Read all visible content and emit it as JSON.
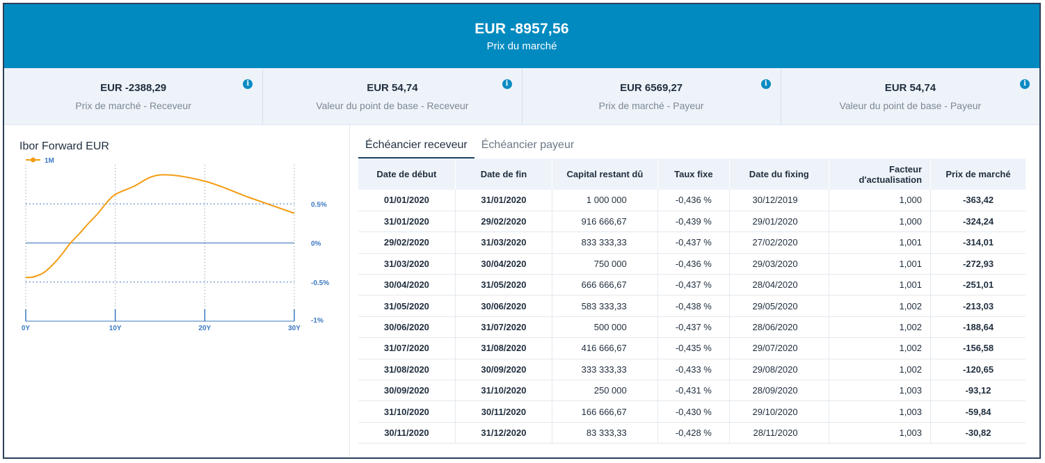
{
  "header": {
    "value": "EUR -8957,56",
    "label": "Prix du marché"
  },
  "kpis": [
    {
      "value": "EUR -2388,29",
      "label": "Prix de marché - Receveur",
      "icon": "info-icon"
    },
    {
      "value": "EUR 54,74",
      "label": "Valeur du point de base - Receveur",
      "icon": "info-icon"
    },
    {
      "value": "EUR 6569,27",
      "label": "Prix de marché - Payeur",
      "icon": "info-icon"
    },
    {
      "value": "EUR 54,74",
      "label": "Valeur du point de base - Payeur",
      "icon": "info-icon"
    }
  ],
  "info_glyph": "i",
  "chart_data": {
    "type": "line",
    "title": "Ibor Forward EUR",
    "series": [
      {
        "name": "1M",
        "color": "#f39c12",
        "x": [
          0,
          0.5,
          1,
          2,
          3,
          4,
          5,
          6,
          7,
          8,
          9,
          10,
          12,
          15,
          20,
          25,
          30
        ],
        "y": [
          -0.44,
          -0.44,
          -0.43,
          -0.38,
          -0.28,
          -0.15,
          0.0,
          0.12,
          0.25,
          0.37,
          0.51,
          0.62,
          0.72,
          0.87,
          0.79,
          0.58,
          0.38
        ]
      }
    ],
    "x_ticks": [
      "0Y",
      "10Y",
      "20Y",
      "30Y"
    ],
    "x_tick_values": [
      0,
      10,
      20,
      30
    ],
    "y_ticks": [
      "0.5%",
      "0%",
      "-0.5%",
      "-1%"
    ],
    "y_tick_values": [
      0.5,
      0,
      -0.5,
      -1
    ],
    "xlim": [
      0,
      30
    ],
    "ylim": [
      -1,
      1
    ],
    "grid": true,
    "legend": "top-left",
    "y_axis_side": "right"
  },
  "tabs": [
    {
      "label": "Échéancier receveur",
      "active": true
    },
    {
      "label": "Échéancier payeur",
      "active": false
    }
  ],
  "table": {
    "columns": [
      "Date de début",
      "Date de fin",
      "Capital restant dû",
      "Taux fixe",
      "Date du fixing",
      "Facteur d'actualisation",
      "Prix de marché"
    ],
    "rows": [
      [
        "01/01/2020",
        "31/01/2020",
        "1 000 000",
        "-0,436 %",
        "30/12/2019",
        "1,000",
        "-363,42"
      ],
      [
        "31/01/2020",
        "29/02/2020",
        "916 666,67",
        "-0,439 %",
        "29/01/2020",
        "1,000",
        "-324,24"
      ],
      [
        "29/02/2020",
        "31/03/2020",
        "833 333,33",
        "-0,437 %",
        "27/02/2020",
        "1,001",
        "-314,01"
      ],
      [
        "31/03/2020",
        "30/04/2020",
        "750 000",
        "-0,436 %",
        "29/03/2020",
        "1,001",
        "-272,93"
      ],
      [
        "30/04/2020",
        "31/05/2020",
        "666 666,67",
        "-0,437 %",
        "28/04/2020",
        "1,001",
        "-251,01"
      ],
      [
        "31/05/2020",
        "30/06/2020",
        "583 333,33",
        "-0,438 %",
        "29/05/2020",
        "1,002",
        "-213,03"
      ],
      [
        "30/06/2020",
        "31/07/2020",
        "500 000",
        "-0,437 %",
        "28/06/2020",
        "1,002",
        "-188,64"
      ],
      [
        "31/07/2020",
        "31/08/2020",
        "416 666,67",
        "-0,435 %",
        "29/07/2020",
        "1,002",
        "-156,58"
      ],
      [
        "31/08/2020",
        "30/09/2020",
        "333 333,33",
        "-0,433 %",
        "29/08/2020",
        "1,002",
        "-120,65"
      ],
      [
        "30/09/2020",
        "31/10/2020",
        "250 000",
        "-0,431 %",
        "28/09/2020",
        "1,003",
        "-93,12"
      ],
      [
        "31/10/2020",
        "30/11/2020",
        "166 666,67",
        "-0,430 %",
        "29/10/2020",
        "1,003",
        "-59,84"
      ],
      [
        "30/11/2020",
        "31/12/2020",
        "83 333,33",
        "-0,428 %",
        "28/11/2020",
        "1,003",
        "-30,82"
      ]
    ]
  }
}
